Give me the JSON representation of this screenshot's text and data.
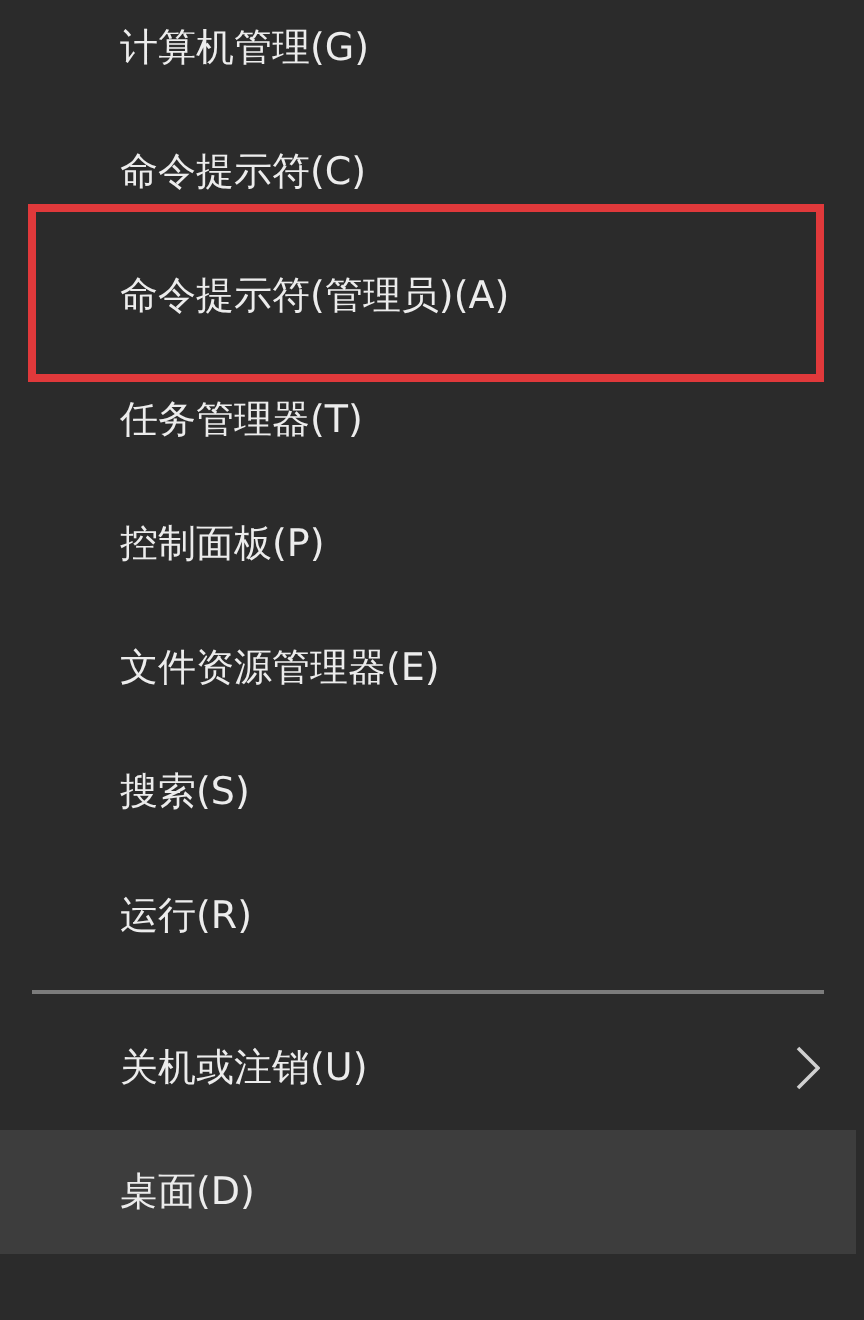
{
  "menu": {
    "items": [
      {
        "kind": "item",
        "label": "计算机管理(G)",
        "selected": false,
        "marked": false,
        "submenu": false
      },
      {
        "kind": "item",
        "label": "命令提示符(C)",
        "selected": false,
        "marked": false,
        "submenu": false
      },
      {
        "kind": "item",
        "label": "命令提示符(管理员)(A)",
        "selected": false,
        "marked": true,
        "submenu": false
      },
      {
        "kind": "item",
        "label": "任务管理器(T)",
        "selected": false,
        "marked": false,
        "submenu": false
      },
      {
        "kind": "item",
        "label": "控制面板(P)",
        "selected": false,
        "marked": false,
        "submenu": false
      },
      {
        "kind": "item",
        "label": "文件资源管理器(E)",
        "selected": false,
        "marked": false,
        "submenu": false
      },
      {
        "kind": "item",
        "label": "搜索(S)",
        "selected": false,
        "marked": false,
        "submenu": false
      },
      {
        "kind": "item",
        "label": "运行(R)",
        "selected": false,
        "marked": false,
        "submenu": false
      },
      {
        "kind": "separator"
      },
      {
        "kind": "item",
        "label": "关机或注销(U)",
        "selected": false,
        "marked": false,
        "submenu": true
      },
      {
        "kind": "item",
        "label": "桌面(D)",
        "selected": true,
        "marked": false,
        "submenu": false
      }
    ]
  }
}
